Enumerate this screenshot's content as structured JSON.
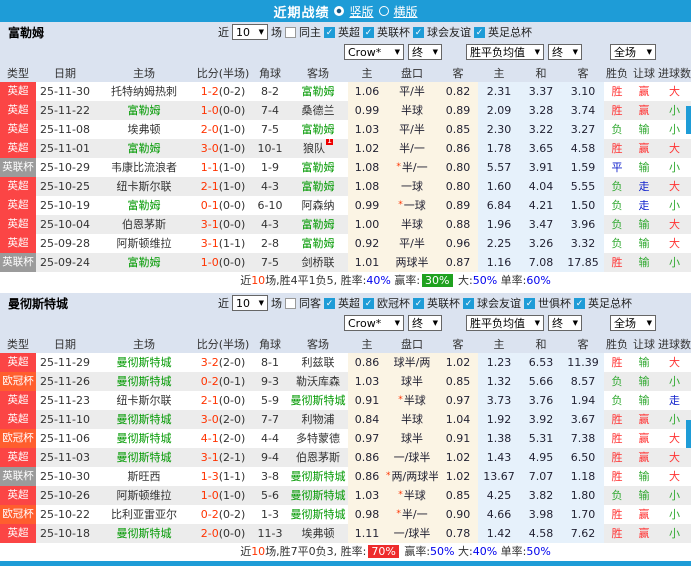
{
  "titlebar": {
    "title": "近期战绩",
    "vertical": "竖版",
    "horizontal": "横版"
  },
  "labels": {
    "recent_pre": "近",
    "recent_post": "场"
  },
  "markers": {
    "check": "✓",
    "star": "*"
  },
  "dropdowns": {
    "recent_count": "10",
    "odds_company": "Crow*",
    "final": "终",
    "avg": "胜平负均值",
    "scope": "全场"
  },
  "columns": {
    "type": "类型",
    "date": "日期",
    "home": "主场",
    "score": "比分(半场)",
    "corner": "角球",
    "away": "客场",
    "odds_home": "主",
    "handicap": "盘口",
    "odds_away": "客",
    "avg_home": "主",
    "avg_draw": "和",
    "avg_away": "客",
    "result": "胜负",
    "let_result": "让球",
    "goals_result": "进球数"
  },
  "colors": {
    "accent_blue": "#1e9cd7",
    "league_red": "#fb4545",
    "cup_orange": "#ff5e2e",
    "league_cup_gray": "#9b9b9b",
    "focus_team_green": "#009900",
    "score_red": "#ff3300",
    "win_red": "#ff3333",
    "lose_green": "#33a033",
    "push_blue": "#1122cc",
    "badge_green": "#1fa11f",
    "badge_red": "#ee2b2b"
  },
  "tables": [
    {
      "team": "富勒姆",
      "same_venue_label": "同主",
      "filters": [
        "英超",
        "英联杯",
        "球会友谊",
        "英足总杯"
      ],
      "rows": [
        {
          "type": "英超",
          "date": "25-11-30",
          "home": "托特纳姆热刺",
          "home_focus": false,
          "score": "1-2",
          "half": "(0-2)",
          "corner": "8-2",
          "away": "富勒姆",
          "away_focus": true,
          "odds_home": "1.06",
          "handicap": "平/半",
          "star": false,
          "odds_away": "0.82",
          "avg_home": "2.31",
          "avg_draw": "3.37",
          "avg_away": "3.10",
          "result": "胜",
          "let_result": "赢",
          "goals_result": "大"
        },
        {
          "type": "英超",
          "date": "25-11-22",
          "home": "富勒姆",
          "home_focus": true,
          "score": "1-0",
          "half": "(0-0)",
          "corner": "7-4",
          "away": "桑德兰",
          "away_focus": false,
          "odds_home": "0.99",
          "handicap": "半球",
          "star": false,
          "odds_away": "0.89",
          "avg_home": "2.09",
          "avg_draw": "3.28",
          "avg_away": "3.74",
          "result": "胜",
          "let_result": "赢",
          "goals_result": "小"
        },
        {
          "type": "英超",
          "date": "25-11-08",
          "home": "埃弗顿",
          "home_focus": false,
          "score": "2-0",
          "half": "(1-0)",
          "corner": "7-5",
          "away": "富勒姆",
          "away_focus": true,
          "odds_home": "1.03",
          "handicap": "平/半",
          "star": false,
          "odds_away": "0.85",
          "avg_home": "2.30",
          "avg_draw": "3.22",
          "avg_away": "3.27",
          "result": "负",
          "let_result": "输",
          "goals_result": "小"
        },
        {
          "type": "英超",
          "date": "25-11-01",
          "home": "富勒姆",
          "home_focus": true,
          "score": "3-0",
          "half": "(1-0)",
          "corner": "10-1",
          "away": "狼队",
          "away_focus": false,
          "red_card": "1",
          "odds_home": "1.02",
          "handicap": "半/一",
          "star": false,
          "odds_away": "0.86",
          "avg_home": "1.78",
          "avg_draw": "3.65",
          "avg_away": "4.58",
          "result": "胜",
          "let_result": "赢",
          "goals_result": "大"
        },
        {
          "type": "英联杯",
          "date": "25-10-29",
          "home": "韦康比流浪者",
          "home_focus": false,
          "score": "1-1",
          "half": "(1-0)",
          "corner": "1-9",
          "away": "富勒姆",
          "away_focus": true,
          "odds_home": "1.08",
          "handicap": "半/一",
          "star": true,
          "odds_away": "0.80",
          "avg_home": "5.57",
          "avg_draw": "3.91",
          "avg_away": "1.59",
          "result": "平",
          "let_result": "输",
          "goals_result": "小"
        },
        {
          "type": "英超",
          "date": "25-10-25",
          "home": "纽卡斯尔联",
          "home_focus": false,
          "score": "2-1",
          "half": "(1-0)",
          "corner": "4-3",
          "away": "富勒姆",
          "away_focus": true,
          "odds_home": "1.08",
          "handicap": "一球",
          "star": false,
          "odds_away": "0.80",
          "avg_home": "1.60",
          "avg_draw": "4.04",
          "avg_away": "5.55",
          "result": "负",
          "let_result": "走",
          "goals_result": "大"
        },
        {
          "type": "英超",
          "date": "25-10-19",
          "home": "富勒姆",
          "home_focus": true,
          "score": "0-1",
          "half": "(0-0)",
          "corner": "6-10",
          "away": "阿森纳",
          "away_focus": false,
          "odds_home": "0.99",
          "handicap": "一球",
          "star": true,
          "odds_away": "0.89",
          "avg_home": "6.84",
          "avg_draw": "4.21",
          "avg_away": "1.50",
          "result": "负",
          "let_result": "走",
          "goals_result": "小"
        },
        {
          "type": "英超",
          "date": "25-10-04",
          "home": "伯恩茅斯",
          "home_focus": false,
          "score": "3-1",
          "half": "(0-0)",
          "corner": "4-3",
          "away": "富勒姆",
          "away_focus": true,
          "odds_home": "1.00",
          "handicap": "半球",
          "star": false,
          "odds_away": "0.88",
          "avg_home": "1.96",
          "avg_draw": "3.47",
          "avg_away": "3.96",
          "result": "负",
          "let_result": "输",
          "goals_result": "大"
        },
        {
          "type": "英超",
          "date": "25-09-28",
          "home": "阿斯顿维拉",
          "home_focus": false,
          "score": "3-1",
          "half": "(1-1)",
          "corner": "2-8",
          "away": "富勒姆",
          "away_focus": true,
          "odds_home": "0.92",
          "handicap": "平/半",
          "star": false,
          "odds_away": "0.96",
          "avg_home": "2.25",
          "avg_draw": "3.26",
          "avg_away": "3.32",
          "result": "负",
          "let_result": "输",
          "goals_result": "大"
        },
        {
          "type": "英联杯",
          "date": "25-09-24",
          "home": "富勒姆",
          "home_focus": true,
          "score": "1-0",
          "half": "(0-0)",
          "corner": "7-5",
          "away": "剑桥联",
          "away_focus": false,
          "odds_home": "1.01",
          "handicap": "两球半",
          "star": false,
          "odds_away": "0.87",
          "avg_home": "1.16",
          "avg_draw": "7.08",
          "avg_away": "17.85",
          "result": "胜",
          "let_result": "输",
          "goals_result": "小"
        }
      ],
      "summary": [
        {
          "t": "近",
          "s": "k"
        },
        {
          "t": "10",
          "s": "r"
        },
        {
          "t": "场,胜4平1负5, 胜率:",
          "s": "k"
        },
        {
          "t": "40%",
          "s": "b"
        },
        {
          "t": " 赢率:",
          "s": "k"
        },
        {
          "t": "30%",
          "s": "bg"
        },
        {
          "t": " 大:",
          "s": "k"
        },
        {
          "t": "50%",
          "s": "b"
        },
        {
          "t": " 单率:",
          "s": "k"
        },
        {
          "t": "60%",
          "s": "b"
        }
      ]
    },
    {
      "team": "曼彻斯特城",
      "same_venue_label": "同客",
      "filters": [
        "英超",
        "欧冠杯",
        "英联杯",
        "球会友谊",
        "世俱杯",
        "英足总杯"
      ],
      "rows": [
        {
          "type": "英超",
          "date": "25-11-29",
          "home": "曼彻斯特城",
          "home_focus": true,
          "score": "3-2",
          "half": "(2-0)",
          "corner": "8-1",
          "away": "利兹联",
          "away_focus": false,
          "odds_home": "0.86",
          "handicap": "球半/两",
          "star": false,
          "odds_away": "1.02",
          "avg_home": "1.23",
          "avg_draw": "6.53",
          "avg_away": "11.39",
          "result": "胜",
          "let_result": "输",
          "goals_result": "大"
        },
        {
          "type": "欧冠杯",
          "date": "25-11-26",
          "home": "曼彻斯特城",
          "home_focus": true,
          "score": "0-2",
          "half": "(0-1)",
          "corner": "9-3",
          "away": "勒沃库森",
          "away_focus": false,
          "odds_home": "1.03",
          "handicap": "球半",
          "star": false,
          "odds_away": "0.85",
          "avg_home": "1.32",
          "avg_draw": "5.66",
          "avg_away": "8.57",
          "result": "负",
          "let_result": "输",
          "goals_result": "小"
        },
        {
          "type": "英超",
          "date": "25-11-23",
          "home": "纽卡斯尔联",
          "home_focus": false,
          "score": "2-1",
          "half": "(0-0)",
          "corner": "5-9",
          "away": "曼彻斯特城",
          "away_focus": true,
          "odds_home": "0.91",
          "handicap": "半球",
          "star": true,
          "odds_away": "0.97",
          "avg_home": "3.73",
          "avg_draw": "3.76",
          "avg_away": "1.94",
          "result": "负",
          "let_result": "输",
          "goals_result": "走"
        },
        {
          "type": "英超",
          "date": "25-11-10",
          "home": "曼彻斯特城",
          "home_focus": true,
          "score": "3-0",
          "half": "(2-0)",
          "corner": "7-7",
          "away": "利物浦",
          "away_focus": false,
          "odds_home": "0.84",
          "handicap": "半球",
          "star": false,
          "odds_away": "1.04",
          "avg_home": "1.92",
          "avg_draw": "3.92",
          "avg_away": "3.67",
          "result": "胜",
          "let_result": "赢",
          "goals_result": "小"
        },
        {
          "type": "欧冠杯",
          "date": "25-11-06",
          "home": "曼彻斯特城",
          "home_focus": true,
          "score": "4-1",
          "half": "(2-0)",
          "corner": "4-4",
          "away": "多特蒙德",
          "away_focus": false,
          "odds_home": "0.97",
          "handicap": "球半",
          "star": false,
          "odds_away": "0.91",
          "avg_home": "1.38",
          "avg_draw": "5.31",
          "avg_away": "7.38",
          "result": "胜",
          "let_result": "赢",
          "goals_result": "大"
        },
        {
          "type": "英超",
          "date": "25-11-03",
          "home": "曼彻斯特城",
          "home_focus": true,
          "score": "3-1",
          "half": "(2-1)",
          "corner": "9-4",
          "away": "伯恩茅斯",
          "away_focus": false,
          "odds_home": "0.86",
          "handicap": "一/球半",
          "star": false,
          "odds_away": "1.02",
          "avg_home": "1.43",
          "avg_draw": "4.95",
          "avg_away": "6.50",
          "result": "胜",
          "let_result": "赢",
          "goals_result": "大"
        },
        {
          "type": "英联杯",
          "date": "25-10-30",
          "home": "斯旺西",
          "home_focus": false,
          "score": "1-3",
          "half": "(1-1)",
          "corner": "3-8",
          "away": "曼彻斯特城",
          "away_focus": true,
          "odds_home": "0.86",
          "handicap": "两/两球半",
          "star": true,
          "odds_away": "1.02",
          "avg_home": "13.67",
          "avg_draw": "7.07",
          "avg_away": "1.18",
          "result": "胜",
          "let_result": "输",
          "goals_result": "大"
        },
        {
          "type": "英超",
          "date": "25-10-26",
          "home": "阿斯顿维拉",
          "home_focus": false,
          "score": "1-0",
          "half": "(1-0)",
          "corner": "5-6",
          "away": "曼彻斯特城",
          "away_focus": true,
          "odds_home": "1.03",
          "handicap": "半球",
          "star": true,
          "odds_away": "0.85",
          "avg_home": "4.25",
          "avg_draw": "3.82",
          "avg_away": "1.80",
          "result": "负",
          "let_result": "输",
          "goals_result": "小"
        },
        {
          "type": "欧冠杯",
          "date": "25-10-22",
          "home": "比利亚雷亚尔",
          "home_focus": false,
          "score": "0-2",
          "half": "(0-2)",
          "corner": "1-3",
          "away": "曼彻斯特城",
          "away_focus": true,
          "odds_home": "0.98",
          "handicap": "半/一",
          "star": true,
          "odds_away": "0.90",
          "avg_home": "4.66",
          "avg_draw": "3.98",
          "avg_away": "1.70",
          "result": "胜",
          "let_result": "赢",
          "goals_result": "小"
        },
        {
          "type": "英超",
          "date": "25-10-18",
          "home": "曼彻斯特城",
          "home_focus": true,
          "score": "2-0",
          "half": "(0-0)",
          "corner": "11-3",
          "away": "埃弗顿",
          "away_focus": false,
          "odds_home": "1.11",
          "handicap": "一/球半",
          "star": false,
          "odds_away": "0.78",
          "avg_home": "1.42",
          "avg_draw": "4.58",
          "avg_away": "7.62",
          "result": "胜",
          "let_result": "赢",
          "goals_result": "小"
        }
      ],
      "summary": [
        {
          "t": "近",
          "s": "k"
        },
        {
          "t": "10",
          "s": "r"
        },
        {
          "t": "场,胜7平0负3, 胜率:",
          "s": "k"
        },
        {
          "t": "70%",
          "s": "br"
        },
        {
          "t": " 赢率:",
          "s": "k"
        },
        {
          "t": "50%",
          "s": "b"
        },
        {
          "t": " 大:",
          "s": "k"
        },
        {
          "t": "40%",
          "s": "b"
        },
        {
          "t": " 单率:",
          "s": "k"
        },
        {
          "t": "50%",
          "s": "b"
        }
      ]
    }
  ]
}
